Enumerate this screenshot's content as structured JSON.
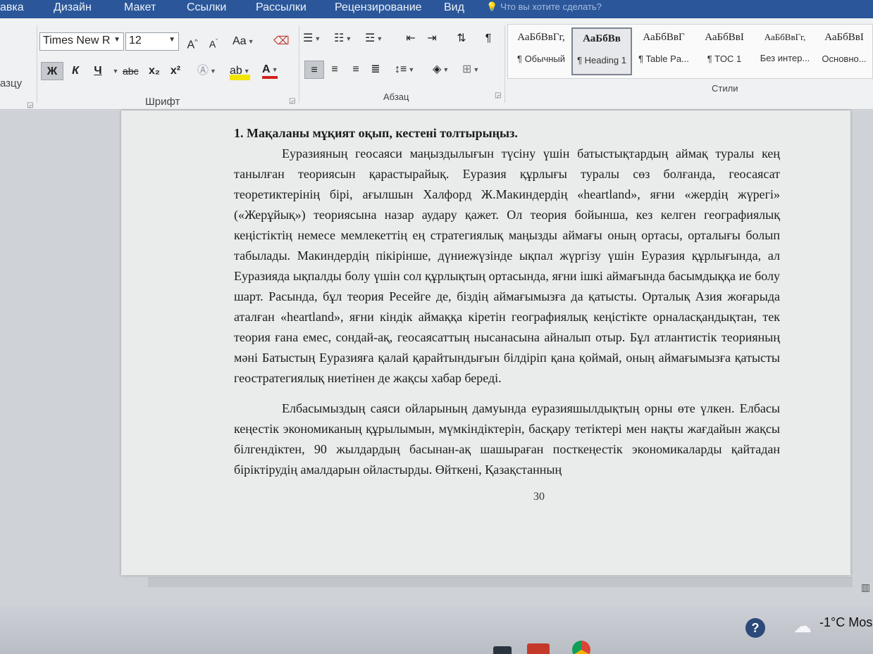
{
  "menu": {
    "tabs": [
      "авка",
      "Дизайн",
      "Макет",
      "Ссылки",
      "Рассылки",
      "Рецензирование",
      "Вид"
    ],
    "tell_me": "Что вы хотите сделать?"
  },
  "ribbon": {
    "clipboard_partial_label": "азцу",
    "font": {
      "name": "Times New R",
      "size": "12",
      "grow": "A",
      "shrink": "A",
      "change_case": "Aa",
      "bold": "Ж",
      "italic": "К",
      "underline": "Ч",
      "strikethrough": "abc",
      "subscript": "x₂",
      "superscript": "x²",
      "font_color": "A",
      "group_label": "Шрифт"
    },
    "paragraph": {
      "group_label": "Абзац",
      "pilcrow": "¶"
    },
    "styles": {
      "group_label": "Стили",
      "items": [
        {
          "preview": "АаБбВвГг,",
          "name": "¶ Обычный"
        },
        {
          "preview": "АаБбВв",
          "name": "¶ Heading 1"
        },
        {
          "preview": "АаБбВвГ",
          "name": "¶ Table Pa..."
        },
        {
          "preview": "АаБбВвI",
          "name": "¶ TOC 1"
        },
        {
          "preview": "АаБбВвГг,",
          "name": "Без интер..."
        },
        {
          "preview": "АаБбВвI",
          "name": "Основно..."
        }
      ]
    }
  },
  "document": {
    "heading": "1. Мақаланы мұқият оқып,  кестені толтырыңыз.",
    "paragraphs": [
      "Еуразияның геосаяси маңыздылығын түсіну үшін батыстықтардың аймақ туралы кең танылған теориясын қарастырайық. Еуразия құрлығы туралы сөз болғанда, геосаясат теоретиктерінің бірі, ағылшын Халфорд Ж.Макиндердің «heartland», яғни «жердің жүрегі» («Жерұйық») теориясына назар аудару қажет. Ол теория бойынша, кез келген географиялық кеңістіктің немесе мемлекеттің ең стратегиялық маңызды аймағы оның ортасы, орталығы болып табылады. Макиндердің пікірінше, дүниежүзінде ықпал жүргізу үшін Еуразия құрлығында, ал Еуразияда ықпалды болу үшін сол құрлықтың ортасында, яғни ішкі аймағында басымдыққа ие болу шарт. Расында, бұл теория Ресейге де, біздің аймағымызға да қатысты. Орталық Азия жоғарыда аталған «heartland», яғни кіндік аймаққа кіретін географиялық кеңістікте орналасқандықтан, тек теория ғана емес, сондай-ақ, геосаясаттың нысанасына айналып отыр. Бұл атлантистік теорияның мәні Батыстың Еуразияға қалай қарайтындығын білдіріп қана қоймай, оның аймағымызға қатысты геостратегиялық ниетінен де жақсы хабар береді.",
      "Елбасымыздың саяси ойларының дамуында еуразияшылдықтың орны өте үлкен. Елбасы кеңестік экономиканың құрылымын, мүмкіндіктерін, басқару тетіктері мен нақты жағдайын жақсы білгендіктен, 90 жылдардың басынан-ақ шашыраған посткеңестік экономикаларды қайтадан біріктірудің амалдарын ойластырды. Өйткені, Қазақстанның"
    ],
    "page_number": "30"
  },
  "taskbar": {
    "help": "?",
    "temperature": "-1°C",
    "weather_text": "Mos"
  }
}
